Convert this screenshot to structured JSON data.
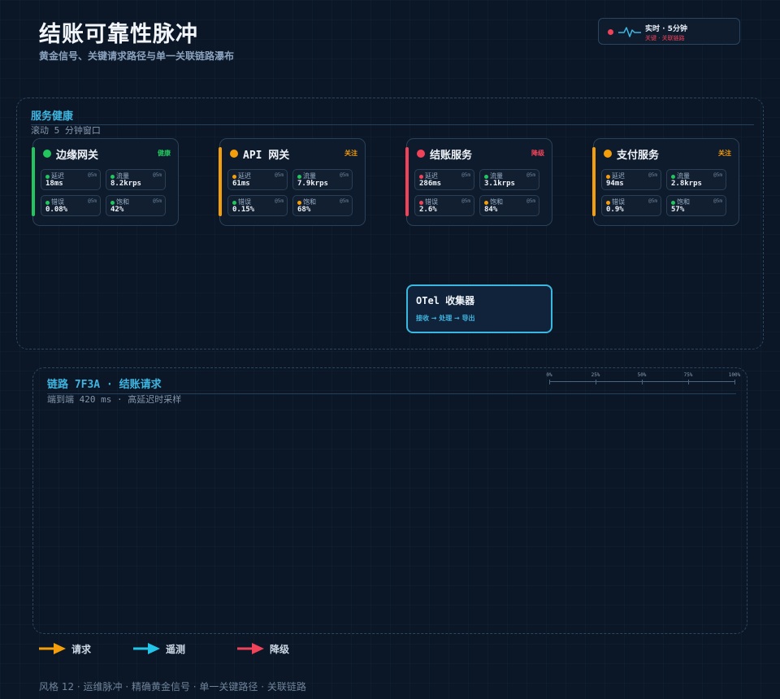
{
  "header": {
    "title": "结账可靠性脉冲",
    "subtitle": "黄金信号、关键请求路径与单一关联链路瀑布"
  },
  "live_badge": {
    "main": "实时 · 5分钟",
    "sub": "关键 · 关联链路",
    "icon": "pulse-wave-icon",
    "dot_color": "#f0435a"
  },
  "health_panel": {
    "title": "服务健康",
    "subtitle": "滚动 5 分钟窗口"
  },
  "colors": {
    "healthy": "#22c55e",
    "watch": "#f59e0b",
    "degraded": "#f0435a",
    "accent": "#3fb5e0"
  },
  "services": [
    {
      "name": "边缘网关",
      "status": "健康",
      "status_color": "#22c55e",
      "metrics": [
        {
          "label": "延迟",
          "window": "@5m",
          "value": "18ms",
          "color": "#22c55e"
        },
        {
          "label": "流量",
          "window": "@5m",
          "value": "8.2krps",
          "color": "#22c55e"
        },
        {
          "label": "错误",
          "window": "@5m",
          "value": "0.08%",
          "color": "#22c55e"
        },
        {
          "label": "饱和",
          "window": "@5m",
          "value": "42%",
          "color": "#22c55e"
        }
      ]
    },
    {
      "name": "API 网关",
      "status": "关注",
      "status_color": "#f59e0b",
      "metrics": [
        {
          "label": "延迟",
          "window": "@5m",
          "value": "61ms",
          "color": "#f59e0b"
        },
        {
          "label": "流量",
          "window": "@5m",
          "value": "7.9krps",
          "color": "#22c55e"
        },
        {
          "label": "错误",
          "window": "@5m",
          "value": "0.15%",
          "color": "#22c55e"
        },
        {
          "label": "饱和",
          "window": "@5m",
          "value": "68%",
          "color": "#f59e0b"
        }
      ]
    },
    {
      "name": "结账服务",
      "status": "降级",
      "status_color": "#f0435a",
      "metrics": [
        {
          "label": "延迟",
          "window": "@5m",
          "value": "286ms",
          "color": "#f0435a"
        },
        {
          "label": "流量",
          "window": "@5m",
          "value": "3.1krps",
          "color": "#22c55e"
        },
        {
          "label": "错误",
          "window": "@5m",
          "value": "2.6%",
          "color": "#f0435a"
        },
        {
          "label": "饱和",
          "window": "@5m",
          "value": "84%",
          "color": "#f59e0b"
        }
      ]
    },
    {
      "name": "支付服务",
      "status": "关注",
      "status_color": "#f59e0b",
      "metrics": [
        {
          "label": "延迟",
          "window": "@5m",
          "value": "94ms",
          "color": "#f59e0b"
        },
        {
          "label": "流量",
          "window": "@5m",
          "value": "2.8krps",
          "color": "#22c55e"
        },
        {
          "label": "错误",
          "window": "@5m",
          "value": "0.9%",
          "color": "#f59e0b"
        },
        {
          "label": "饱和",
          "window": "@5m",
          "value": "57%",
          "color": "#22c55e"
        }
      ]
    }
  ],
  "collector": {
    "title": "OTel 收集器",
    "pipeline": "接收 → 处理 → 导出"
  },
  "trace_panel": {
    "title": "链路 7F3A · 结账请求",
    "subtitle": "端到端 420 ms · 高延迟时采样",
    "scale_ticks": [
      "0%",
      "25%",
      "50%",
      "75%",
      "100%"
    ]
  },
  "legend": [
    {
      "label": "请求",
      "color": "#f59e0b",
      "icon": "arrow-request-icon"
    },
    {
      "label": "遥测",
      "color": "#22c5e8",
      "icon": "arrow-telemetry-icon"
    },
    {
      "label": "降级",
      "color": "#f0435a",
      "icon": "arrow-degraded-icon"
    }
  ],
  "footer": "风格 12 · 运维脉冲 · 精确黄金信号 · 单一关键路径 · 关联链路"
}
